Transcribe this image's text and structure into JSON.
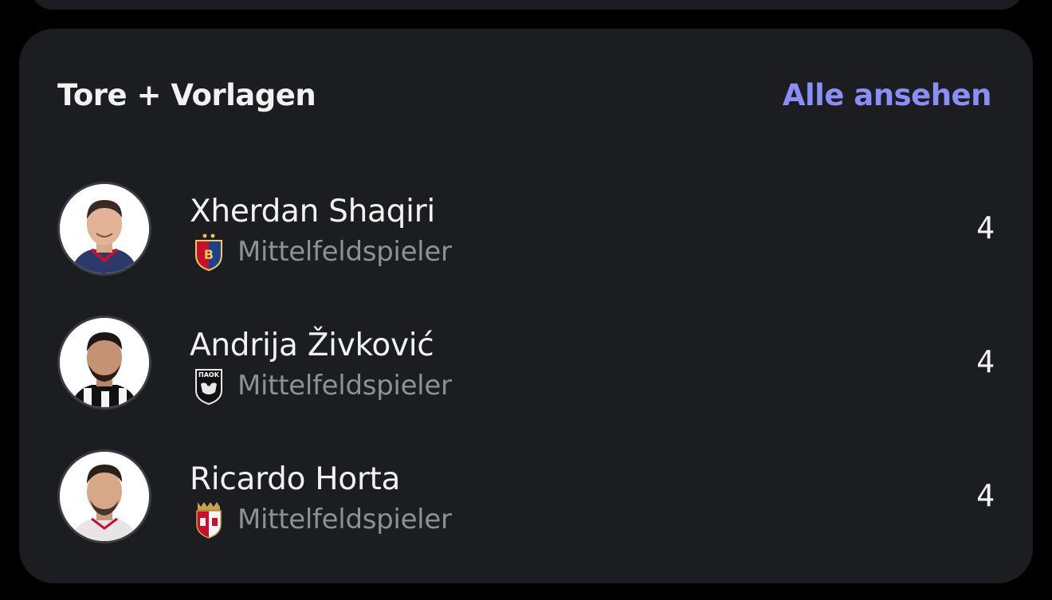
{
  "card": {
    "title": "Tore + Vorlagen",
    "see_all_label": "Alle ansehen"
  },
  "players": [
    {
      "name": "Xherdan Shaqiri",
      "position": "Mittelfeldspieler",
      "stat": "4",
      "club_crest_icon": "fc-basel-crest-icon"
    },
    {
      "name": "Andrija Živković",
      "position": "Mittelfeldspieler",
      "stat": "4",
      "club_crest_icon": "paok-crest-icon"
    },
    {
      "name": "Ricardo Horta",
      "position": "Mittelfeldspieler",
      "stat": "4",
      "club_crest_icon": "sc-braga-crest-icon"
    }
  ],
  "colors": {
    "background": "#000000",
    "card": "#1b1d20",
    "accent": "#8a8ff7",
    "text_primary": "#f2f2f2",
    "text_secondary": "#8e9095"
  }
}
